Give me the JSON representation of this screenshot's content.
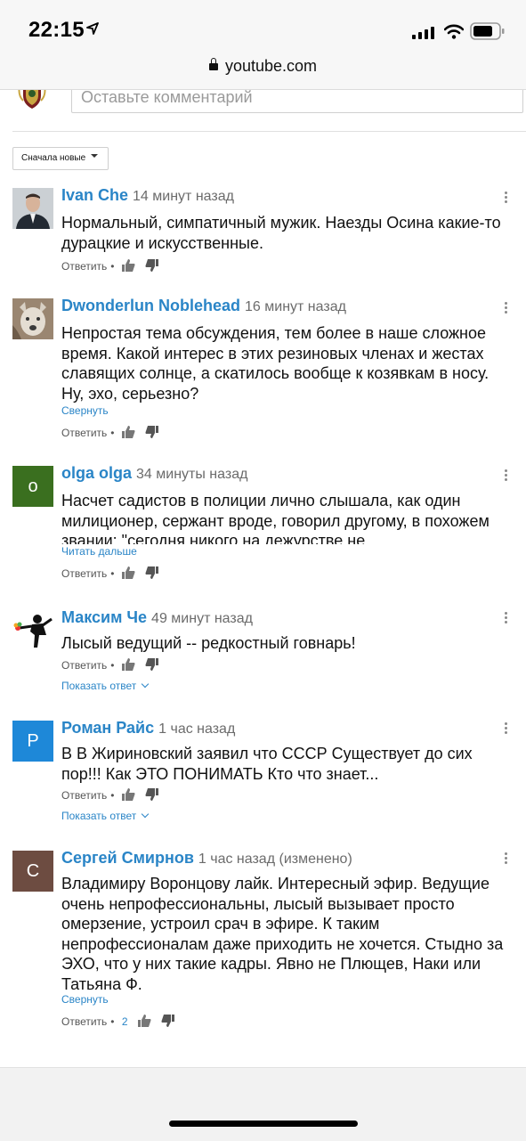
{
  "status_bar": {
    "time": "22:15"
  },
  "browser": {
    "url": "youtube.com"
  },
  "comment_box": {
    "placeholder": "Оставьте комментарий"
  },
  "sort_button": {
    "label": "Сначала новые"
  },
  "colors": {
    "link": "#2a85c7",
    "avatar_olga": "#3a6f1f",
    "avatar_roman": "#1e88d8",
    "avatar_sergey": "#6d4c41"
  },
  "comments": [
    {
      "author": "Ivan Che",
      "time": "14 минут назад",
      "text": "Нормальный, симпатичный мужик. Наезды Осина какие-то дурацкие и искусственные.",
      "reply_label": "Ответить",
      "avatar": "photo-man-suit"
    },
    {
      "author": "Dwonderlun Noblehead",
      "time": "16 минут назад",
      "text": "Непростая тема обсуждения, тем более в наше сложное время. Какой интерес в этих резиновых членах и жестах славящих солнце, а скатилось вообще к козявкам в носу. Ну, эхо, серьезно?",
      "collapse_label": "Свернуть",
      "reply_label": "Ответить",
      "avatar": "photo-wolf"
    },
    {
      "author": "olga olga",
      "time": "34 минуты назад",
      "text": "Насчет садистов в полиции лично слышала, как один милиционер, сержант вроде,  говорил другому, в похожем звании: \"сегодня никого на дежурстве не",
      "read_more_label": "Читать дальше",
      "reply_label": "Ответить",
      "avatar_letter": "о"
    },
    {
      "author": "Максим Че",
      "time": "49 минут назад",
      "text": "Лысый ведущий -- редкостный говнарь!",
      "reply_label": "Ответить",
      "show_replies_label": "Показать ответ",
      "avatar": "banksy-flower-thrower"
    },
    {
      "author": "Роман Райс",
      "time": "1 час назад",
      "text": "В В Жириновский заявил что СССР Существует до сих пор!!! Как ЭТО ПОНИМАТЬ Кто что знает...",
      "reply_label": "Ответить",
      "show_replies_label": "Показать ответ",
      "avatar_letter": "Р"
    },
    {
      "author": "Сергей Смирнов",
      "time": "1 час назад (изменено)",
      "text": "Владимиру Воронцову лайк. Интересный эфир. Ведущие очень непрофессиональны, лысый вызывает просто омерзение, устроил срач в эфире. К таким непрофессионалам даже приходить не хочется. Стыдно за ЭХО, что у них такие кадры. Явно не Плющев, Наки или Татьяна Ф.",
      "collapse_label": "Свернуть",
      "reply_label": "Ответить",
      "likes": "2",
      "avatar_letter": "С"
    }
  ]
}
